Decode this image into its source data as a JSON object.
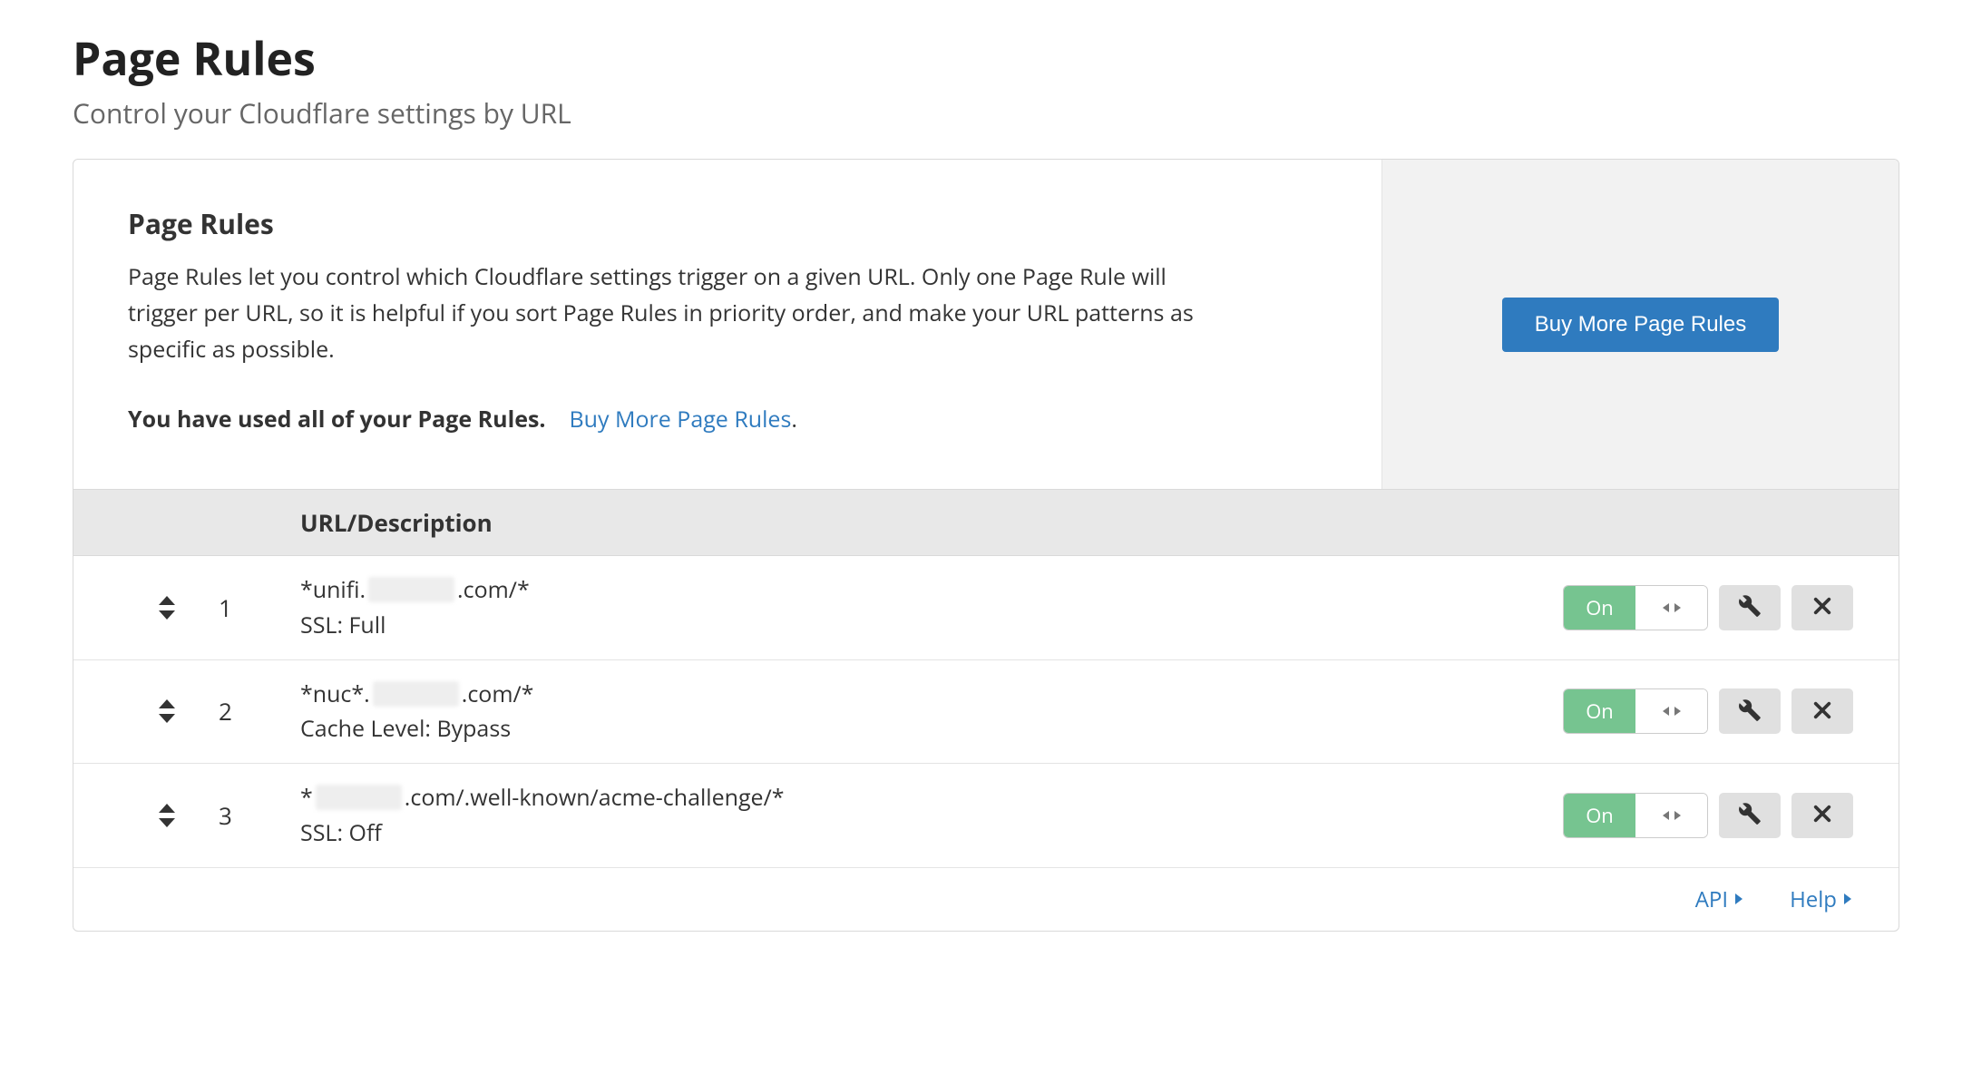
{
  "header": {
    "title": "Page Rules",
    "subtitle": "Control your Cloudflare settings by URL"
  },
  "card": {
    "title": "Page Rules",
    "description": "Page Rules let you control which Cloudflare settings trigger on a given URL. Only one Page Rule will trigger per URL, so it is helpful if you sort Page Rules in priority order, and make your URL patterns as specific as possible.",
    "usage_prefix": "You have used all of your Page Rules.",
    "usage_link": "Buy More Page Rules",
    "usage_suffix": ".",
    "buy_button": "Buy More Page Rules"
  },
  "table": {
    "header": "URL/Description"
  },
  "rules": [
    {
      "order": "1",
      "url_pre": "*unifi.",
      "url_post": ".com/*",
      "settings": "SSL: Full",
      "toggle": "On"
    },
    {
      "order": "2",
      "url_pre": "*nuc*.",
      "url_post": ".com/*",
      "settings": "Cache Level: Bypass",
      "toggle": "On"
    },
    {
      "order": "3",
      "url_pre": "*",
      "url_post": ".com/.well-known/acme-challenge/*",
      "settings": "SSL: Off",
      "toggle": "On"
    }
  ],
  "footer": {
    "api": "API",
    "help": "Help"
  }
}
